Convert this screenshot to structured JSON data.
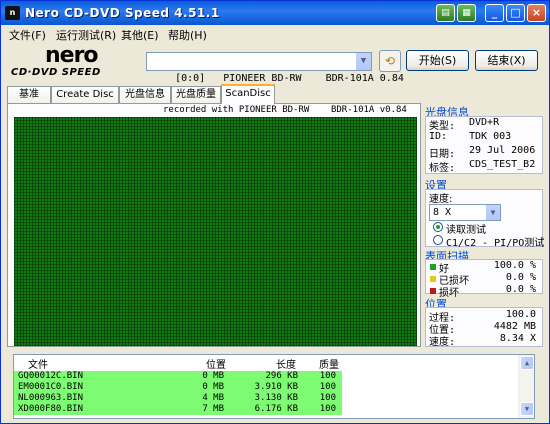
{
  "window": {
    "title": "Nero CD-DVD Speed 4.51.1",
    "icon": "nero-app-icon"
  },
  "title_buttons": {
    "minimize": "_",
    "maximize": "□",
    "close": "×"
  },
  "menu": [
    "文件(F)",
    "运行测试(R)",
    "其他(E)",
    "帮助(H)"
  ],
  "logo": {
    "nero": "nero",
    "product": "CD·DVD SPEED"
  },
  "drive": {
    "selected": "[0:0]   PIONEER BD-RW    BDR-101A 0.84"
  },
  "buttons": {
    "start": "开始(S)",
    "close": "结束(X)"
  },
  "tabs": [
    "基准",
    "Create Disc",
    "光盘信息",
    "光盘质量",
    "ScanDisc"
  ],
  "active_tab": "ScanDisc",
  "recorded_with": "recorded with PIONEER BD-RW    BDR-101A v0.84",
  "disc_info": {
    "header": "光盘信息",
    "rows": [
      {
        "label": "类型:",
        "value": "DVD+R"
      },
      {
        "label": "ID:",
        "value": "TDK 003"
      },
      {
        "label": "日期:",
        "value": "29 Jul 2006"
      },
      {
        "label": "标签:",
        "value": "CDS_TEST_B2"
      }
    ]
  },
  "settings": {
    "header": "设置",
    "speed_label": "速度:",
    "speed_value": "8 X",
    "options": [
      "读取测试",
      "C1/C2 - PI/PO测试"
    ],
    "selected_option": 0
  },
  "surface": {
    "header": "表面扫描",
    "rows": [
      {
        "label": "好",
        "value": "100.0 %",
        "color": "#21a121"
      },
      {
        "label": "已损坏",
        "value": "0.0 %",
        "color": "#e3c81c"
      },
      {
        "label": "损坏",
        "value": "0.0 %",
        "color": "#c01818"
      }
    ]
  },
  "position": {
    "header": "位置",
    "rows": [
      {
        "label": "过程:",
        "value": "100.0"
      },
      {
        "label": "位置:",
        "value": "4482 MB"
      },
      {
        "label": "速度:",
        "value": "8.34 X"
      }
    ]
  },
  "file_list": {
    "headers": [
      "文件",
      "位置",
      "长度",
      "质量"
    ],
    "rows": [
      [
        "GQ00012C.BIN",
        "0 MB",
        "296 KB",
        "100"
      ],
      [
        "EM0001C0.BIN",
        "0 MB",
        "3.910 KB",
        "100"
      ],
      [
        "NL000963.BIN",
        "4 MB",
        "3.130 KB",
        "100"
      ],
      [
        "XD000F80.BIN",
        "7 MB",
        "6.176 KB",
        "100"
      ]
    ]
  }
}
